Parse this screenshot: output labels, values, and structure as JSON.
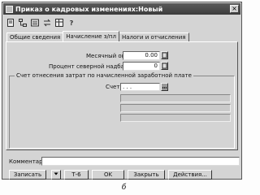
{
  "window": {
    "title": "Приказ о кадровых изменениях:Новый",
    "close_glyph": "×"
  },
  "toolbar": {
    "icons": [
      "document-icon",
      "tree-icon",
      "list-icon",
      "arrows-icon",
      "table-icon",
      "help-icon"
    ],
    "help_glyph": "?"
  },
  "tabs": [
    {
      "label": "Общие сведения",
      "active": false
    },
    {
      "label": "Начисление з/пл",
      "active": true
    },
    {
      "label": "Налоги и отчисления",
      "active": false
    }
  ],
  "salary": {
    "monthly_label": "Месячный оклад:",
    "monthly_value": "0.00",
    "north_label": "Процент северной надбавки:",
    "north_value": "0"
  },
  "cost_group": {
    "title": "Счет отнесения затрат по начисленной заработной плате",
    "account_label": "Счет:",
    "account_value": ". . ."
  },
  "comment": {
    "label": "Комментарий:",
    "value": ""
  },
  "buttons": {
    "record": "Записать",
    "t6": "Т-6",
    "ok": "OK",
    "close": "Закрыть",
    "actions": "Действия..."
  },
  "caption": "б"
}
